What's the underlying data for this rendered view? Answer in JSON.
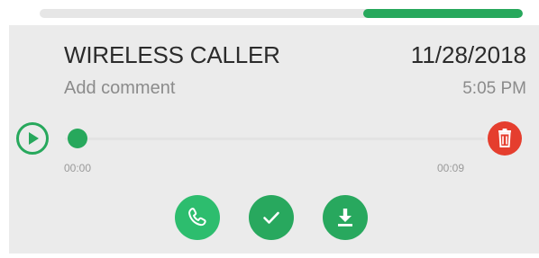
{
  "top_progress": {
    "value_percent": 33
  },
  "call": {
    "caller_name": "WIRELESS CALLER",
    "date": "11/28/2018",
    "time": "5:05 PM",
    "comment_placeholder": "Add comment"
  },
  "player": {
    "position_fraction": 0,
    "current_time": "00:00",
    "duration": "00:09"
  },
  "icons": {
    "play": "play-icon",
    "delete": "trash-icon",
    "call": "phone-icon",
    "check": "checkmark-icon",
    "download": "download-icon"
  },
  "colors": {
    "accent_green": "#27a85c",
    "call_green": "#2dbd6e",
    "delete_red": "#e53e2e"
  }
}
